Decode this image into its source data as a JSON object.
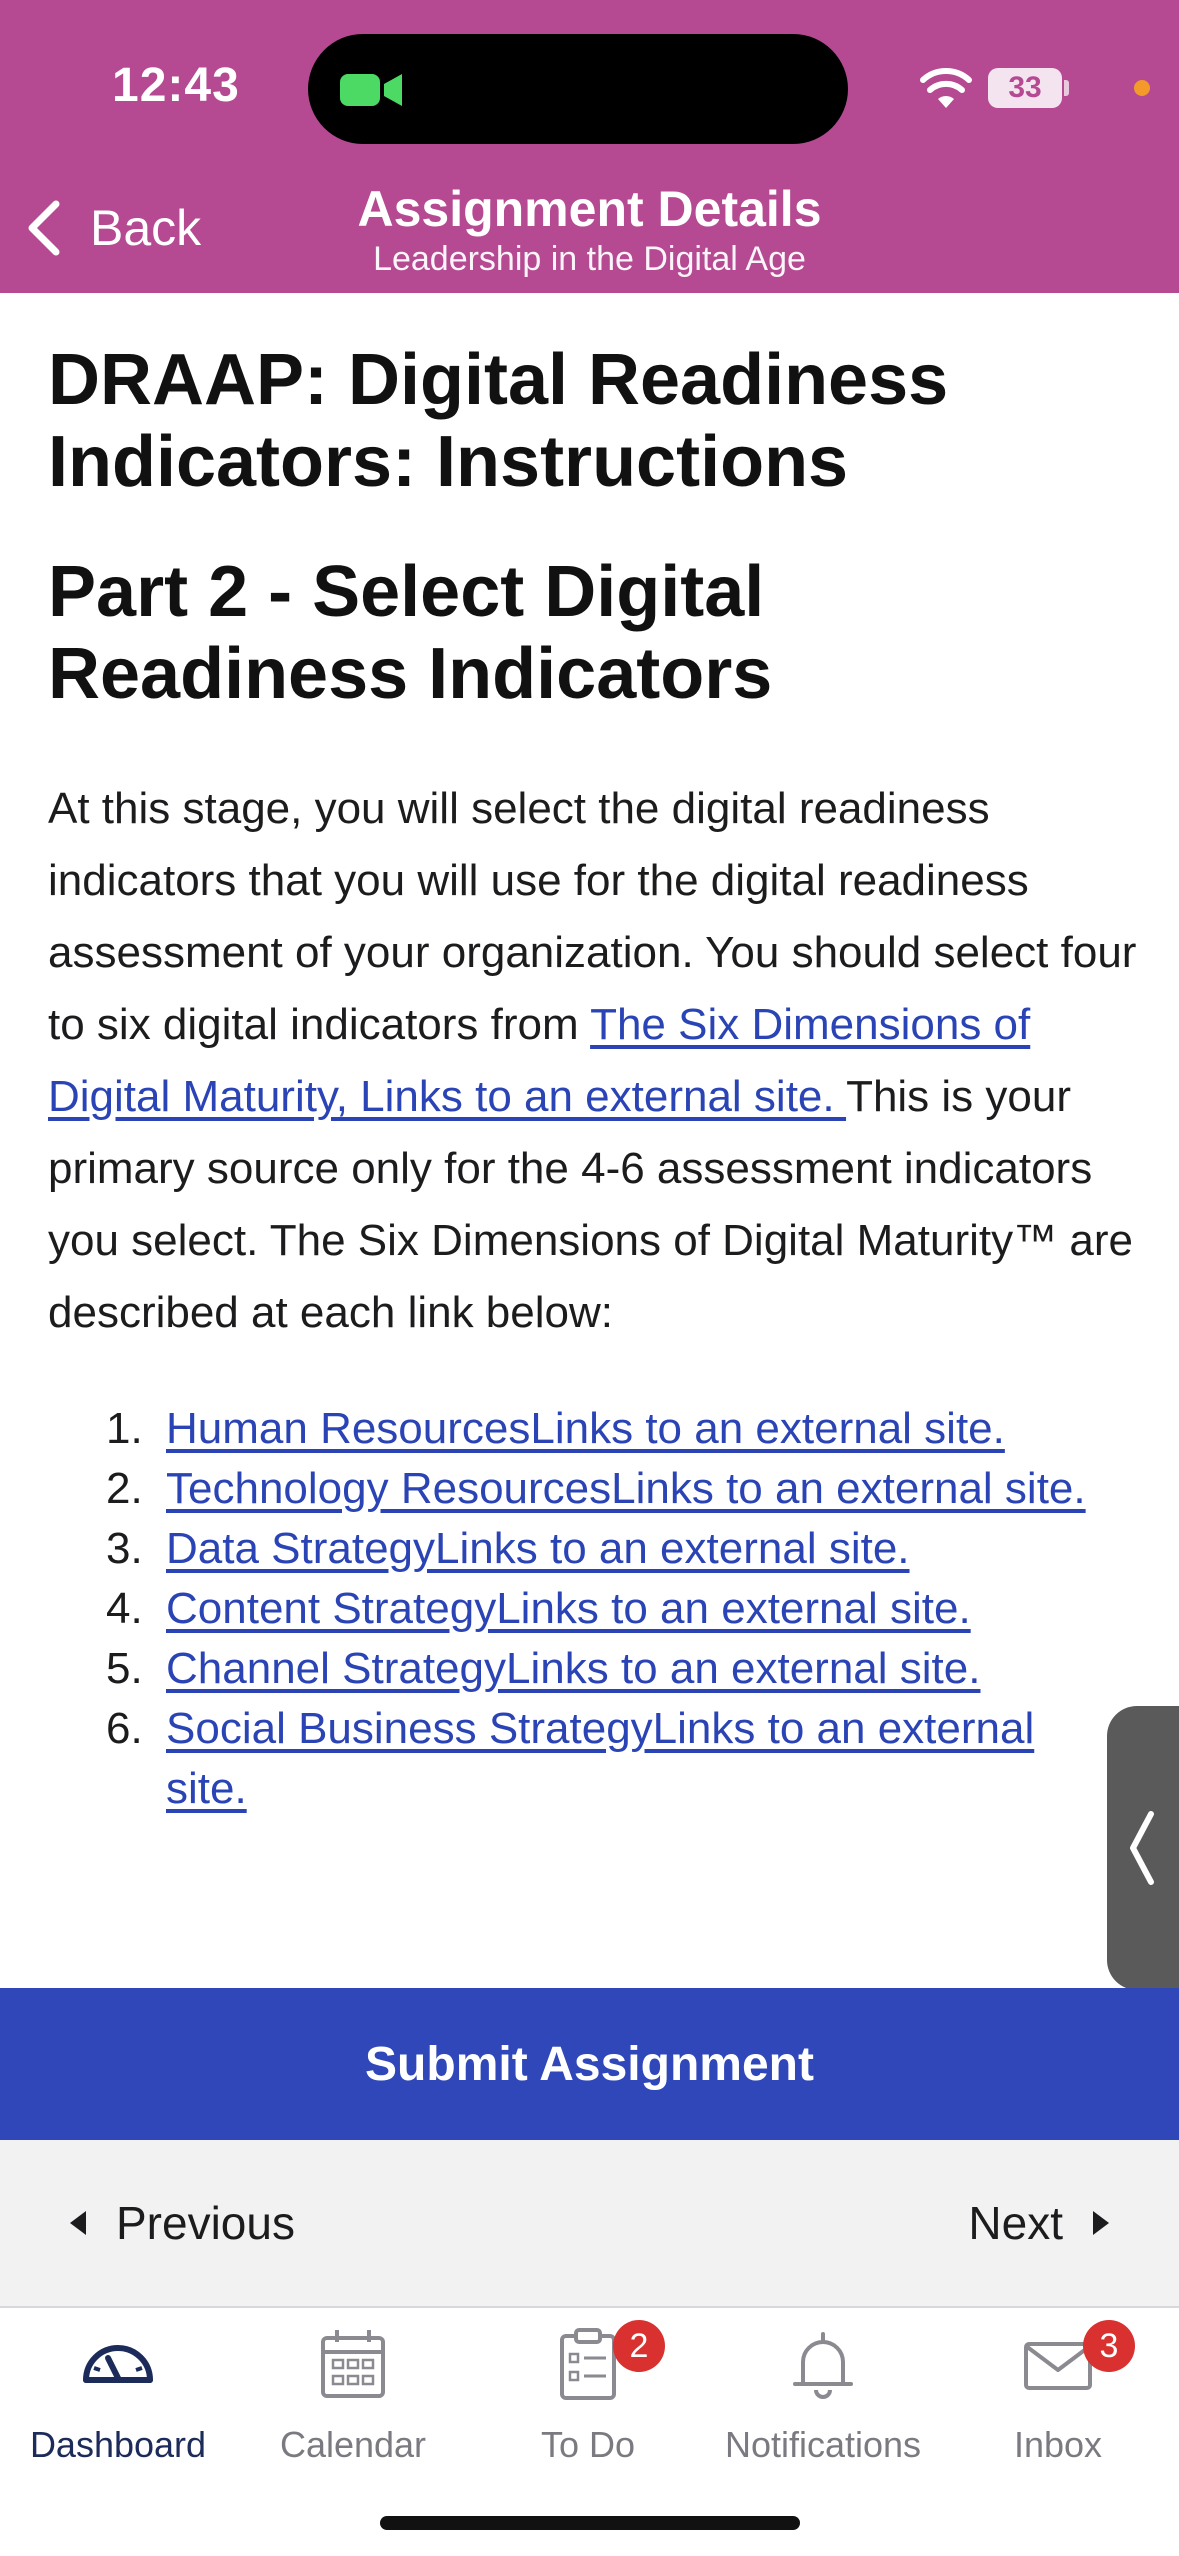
{
  "status": {
    "time": "12:43",
    "battery": "33"
  },
  "nav": {
    "back_label": "Back",
    "title": "Assignment Details",
    "subtitle": "Leadership in the Digital Age"
  },
  "content": {
    "page_title": "DRAAP: Digital Readiness Indicators: Instructions",
    "part_title": "Part 2 - Select Digital Readiness Indicators",
    "para_before_link": "At this stage, you will select the digital readiness indicators that you will use for the digital readiness assessment of your organization. You should select four to six digital indicators from ",
    "para_link": "The Six Dimensions of Digital Maturity, Links to an external site. ",
    "para_after_link": "This is your primary source only for the 4-6 assessment indicators you select. The Six Dimensions of Digital Maturity™ are described at each link below:",
    "links": [
      {
        "num": "1.",
        "text": "Human ResourcesLinks to an external site."
      },
      {
        "num": "2.",
        "text": "Technology ResourcesLinks to an external site."
      },
      {
        "num": "3.",
        "text": "Data StrategyLinks to an external site."
      },
      {
        "num": "4.",
        "text": "Content StrategyLinks to an external site."
      },
      {
        "num": "5.",
        "text": "Channel StrategyLinks to an external site."
      },
      {
        "num": "6.",
        "text": "Social Business StrategyLinks to an external site."
      }
    ]
  },
  "submit_label": "Submit Assignment",
  "pager": {
    "previous": "Previous",
    "next": "Next"
  },
  "tabbar": {
    "items": [
      {
        "label": "Dashboard",
        "icon": "dashboard-icon",
        "active": true
      },
      {
        "label": "Calendar",
        "icon": "calendar-icon"
      },
      {
        "label": "To Do",
        "icon": "todo-icon",
        "badge": "2"
      },
      {
        "label": "Notifications",
        "icon": "bell-icon"
      },
      {
        "label": "Inbox",
        "icon": "inbox-icon",
        "badge": "3"
      }
    ]
  },
  "colors": {
    "header": "#b54a92",
    "submit": "#2f47b8",
    "link": "#2a44b5",
    "badge": "#d8312f"
  }
}
